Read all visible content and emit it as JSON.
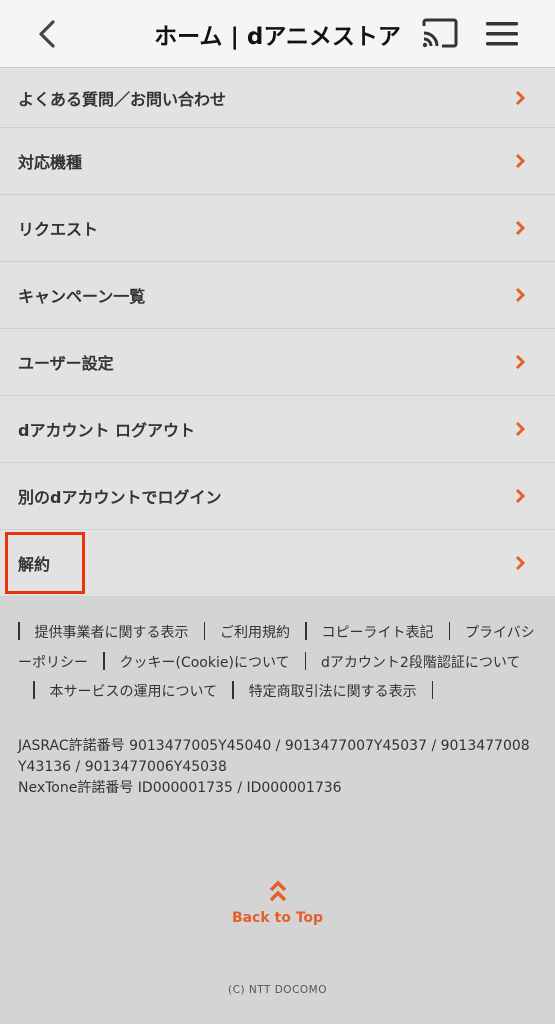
{
  "header": {
    "title": "ホーム | dアニメストア"
  },
  "menu": {
    "items": [
      {
        "label": "よくある質問／お問い合わせ"
      },
      {
        "label": "対応機種"
      },
      {
        "label": "リクエスト"
      },
      {
        "label": "キャンペーン一覧"
      },
      {
        "label": "ユーザー設定"
      },
      {
        "label": "dアカウント ログアウト"
      },
      {
        "label": "別のdアカウントでログイン"
      },
      {
        "label": "解約"
      }
    ]
  },
  "footer": {
    "links": [
      "提供事業者に関する表示",
      "ご利用規約",
      "コピーライト表記",
      "プライバシーポリシー",
      "クッキー(Cookie)について",
      "dアカウント2段階認証について",
      "本サービスの運用について",
      "特定商取引法に関する表示"
    ],
    "jasrac_line1": "JASRAC許諾番号 9013477005Y45040 / 9013477007Y45037 / 9013477008Y43136 / 9013477006Y45038",
    "nextone_line": "NexTone許諾番号 ID000001735 / ID000001736",
    "back_to_top": "Back to Top",
    "copyright": "(C) NTT DOCOMO"
  },
  "colors": {
    "accent": "#e36129",
    "highlight_border": "#e8340c"
  }
}
